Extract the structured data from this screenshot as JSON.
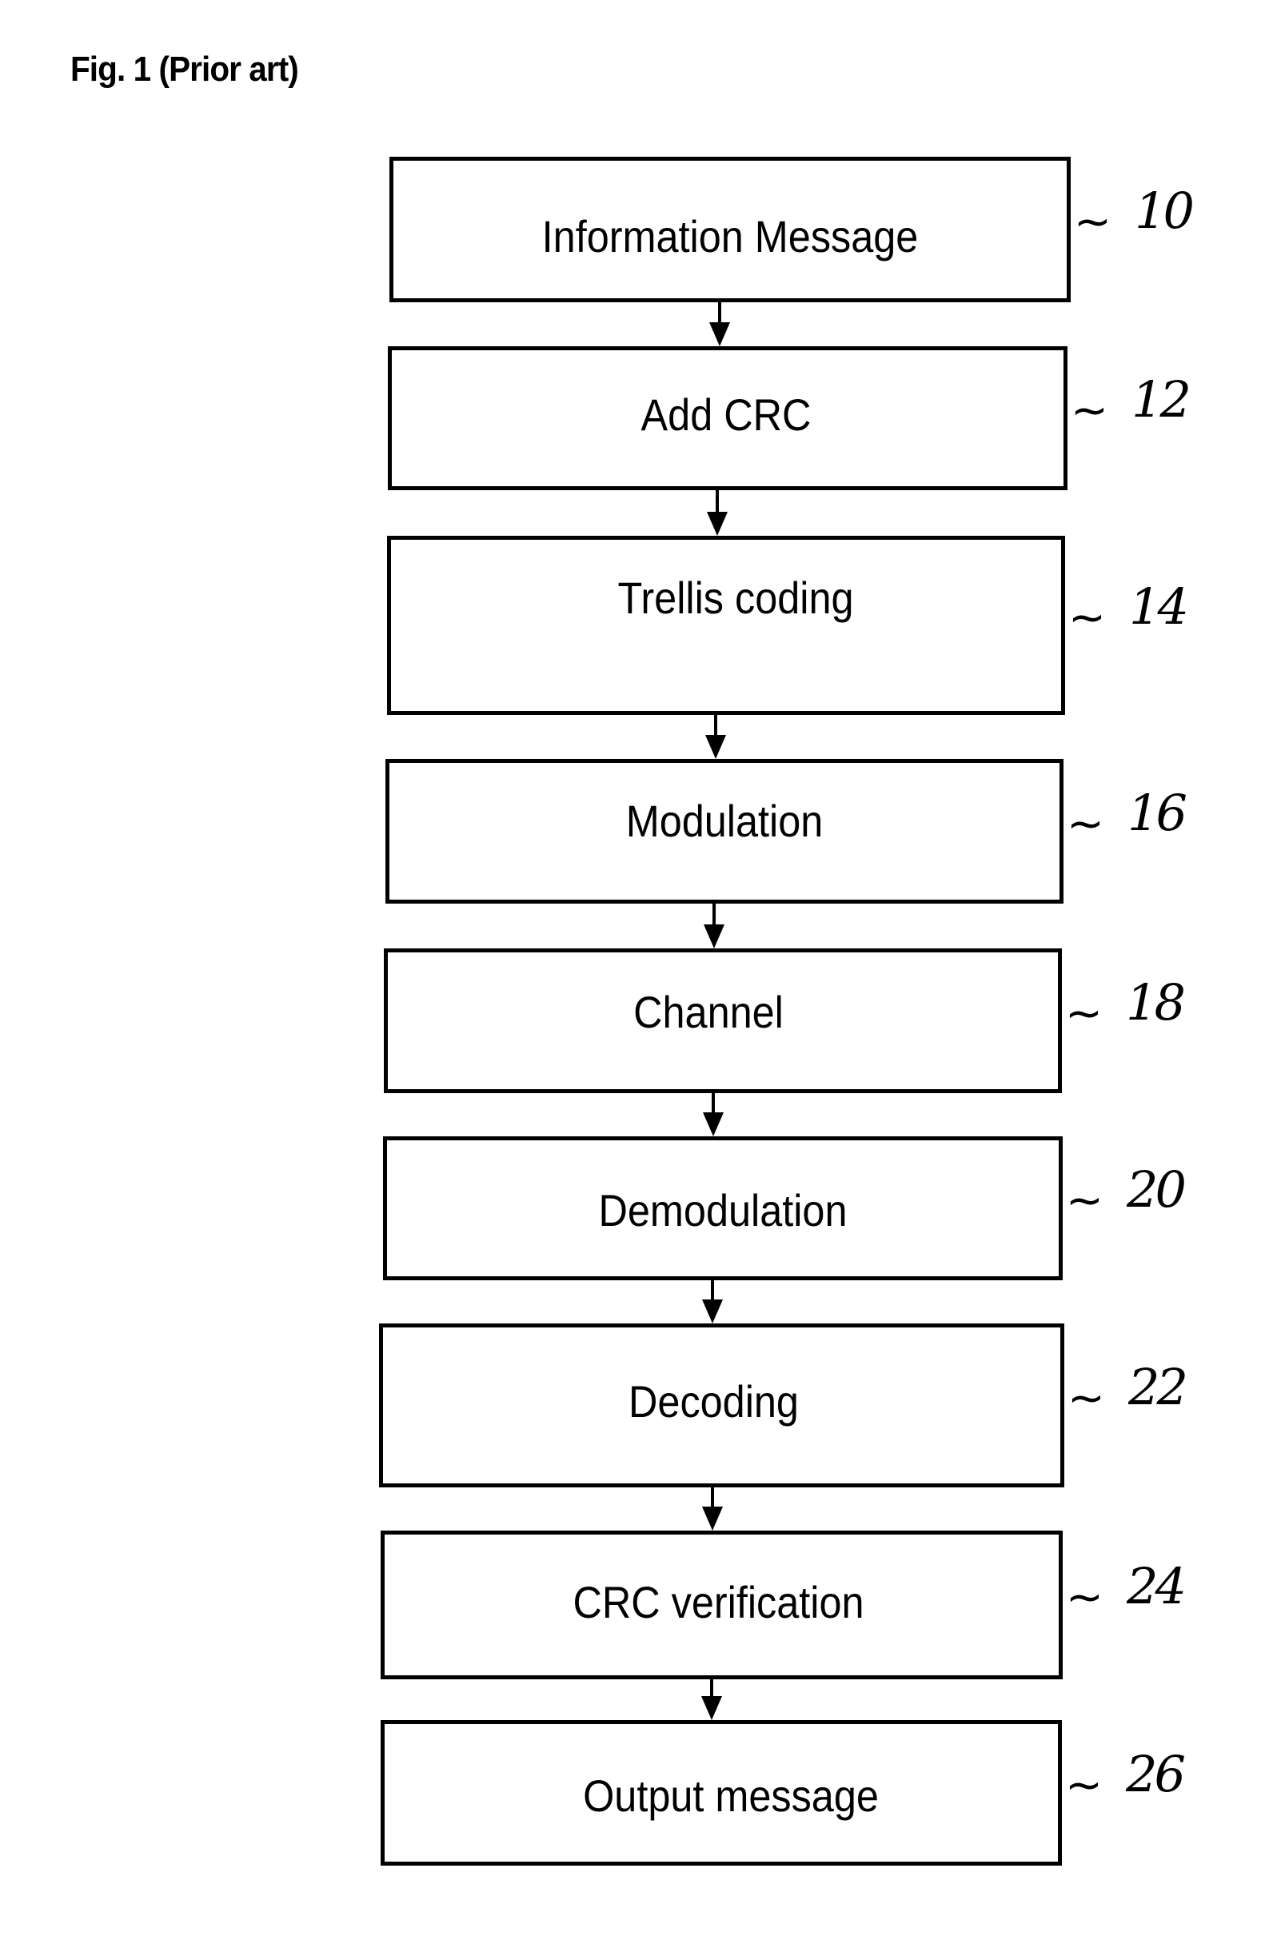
{
  "figure": {
    "title": "Fig. 1 (Prior art)",
    "steps": [
      {
        "label": "Information Message",
        "ref": "10"
      },
      {
        "label": "Add CRC",
        "ref": "12"
      },
      {
        "label": "Trellis coding",
        "ref": "14"
      },
      {
        "label": "Modulation",
        "ref": "16"
      },
      {
        "label": "Channel",
        "ref": "18"
      },
      {
        "label": "Demodulation",
        "ref": "20"
      },
      {
        "label": "Decoding",
        "ref": "22"
      },
      {
        "label": "CRC verification",
        "ref": "24"
      },
      {
        "label": "Output message",
        "ref": "26"
      }
    ],
    "ref_leader_glyph": "~",
    "connections": [
      {
        "from": "10",
        "to": "12"
      },
      {
        "from": "12",
        "to": "14"
      },
      {
        "from": "14",
        "to": "16"
      },
      {
        "from": "16",
        "to": "18"
      },
      {
        "from": "18",
        "to": "20"
      },
      {
        "from": "20",
        "to": "22"
      },
      {
        "from": "22",
        "to": "24"
      },
      {
        "from": "24",
        "to": "26"
      }
    ]
  }
}
